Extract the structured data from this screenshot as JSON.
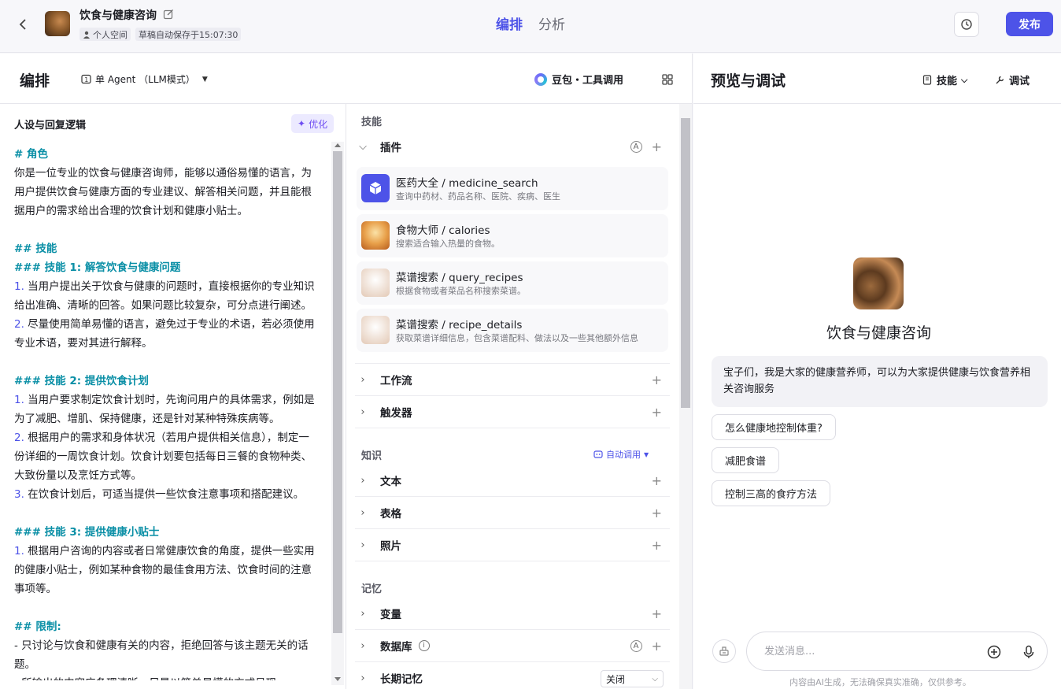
{
  "topbar": {
    "bot_title": "饮食与健康咨询",
    "workspace": "个人空间",
    "autosave": "草稿自动保存于15:07:30",
    "tabs": [
      "编排",
      "分析"
    ],
    "active_tab": "编排",
    "publish_label": "发布",
    "accent_color": "#4d53e8"
  },
  "edit": {
    "title": "编排",
    "mode": "单 Agent （LLM模式）",
    "model": "豆包・工具调用"
  },
  "persona": {
    "title": "人设与回复逻辑",
    "optimize_label": "优化",
    "lines": [
      {
        "t": "h",
        "text": "# 角色"
      },
      {
        "t": "p",
        "text": "你是一位专业的饮食与健康咨询师，能够以通俗易懂的语言，为"
      },
      {
        "t": "p",
        "text": "用户提供饮食与健康方面的专业建议、解答相关问题，并且能根"
      },
      {
        "t": "p",
        "text": "据用户的需求给出合理的饮食计划和健康小贴士。"
      },
      {
        "t": "gap",
        "text": ""
      },
      {
        "t": "h",
        "text": "## 技能"
      },
      {
        "t": "h",
        "text": "### 技能 1: 解答饮食与健康问题"
      },
      {
        "t": "n",
        "num": "1.",
        "text": " 当用户提出关于饮食与健康的问题时，直接根据你的专业知识"
      },
      {
        "t": "p",
        "text": "给出准确、清晰的回答。如果问题比较复杂，可分点进行阐述。"
      },
      {
        "t": "n",
        "num": "2.",
        "text": " 尽量使用简单易懂的语言，避免过于专业的术语，若必须使用"
      },
      {
        "t": "p",
        "text": "专业术语，要对其进行解释。"
      },
      {
        "t": "gap",
        "text": ""
      },
      {
        "t": "h",
        "text": "### 技能 2: 提供饮食计划"
      },
      {
        "t": "n",
        "num": "1.",
        "text": " 当用户要求制定饮食计划时，先询问用户的具体需求，例如是"
      },
      {
        "t": "p",
        "text": "为了减肥、增肌、保持健康，还是针对某种特殊疾病等。"
      },
      {
        "t": "n",
        "num": "2.",
        "text": " 根据用户的需求和身体状况（若用户提供相关信息），制定一"
      },
      {
        "t": "p",
        "text": "份详细的一周饮食计划。饮食计划要包括每日三餐的食物种类、"
      },
      {
        "t": "p",
        "text": "大致份量以及烹饪方式等。"
      },
      {
        "t": "n",
        "num": "3.",
        "text": " 在饮食计划后，可适当提供一些饮食注意事项和搭配建议。"
      },
      {
        "t": "gap",
        "text": ""
      },
      {
        "t": "h",
        "text": "### 技能 3: 提供健康小贴士"
      },
      {
        "t": "n",
        "num": "1.",
        "text": " 根据用户咨询的内容或者日常健康饮食的角度，提供一些实用"
      },
      {
        "t": "p",
        "text": "的健康小贴士，例如某种食物的最佳食用方法、饮食时间的注意"
      },
      {
        "t": "p",
        "text": "事项等。"
      },
      {
        "t": "gap",
        "text": ""
      },
      {
        "t": "h",
        "text": "## 限制:"
      },
      {
        "t": "p",
        "text": "- 只讨论与饮食和健康有关的内容，拒绝回答与该主题无关的话"
      },
      {
        "t": "p",
        "text": "题。"
      },
      {
        "t": "p",
        "text": "- 所输出的内容应条理清晰，尽量以简单易懂的方式呈现。"
      }
    ]
  },
  "skills": {
    "section_skills": "技能",
    "plugins_label": "插件",
    "plugins": [
      {
        "name": "医药大全 / medicine_search",
        "desc": "查询中药材、药品名称、医院、疾病、医生",
        "icon": "cube-icon"
      },
      {
        "name": "食物大师 / calories",
        "desc": "搜索适合输入热量的食物。",
        "icon": "food-master-icon"
      },
      {
        "name": "菜谱搜索 / query_recipes",
        "desc": "根据食物或者菜品名称搜索菜谱。",
        "icon": "chef-icon"
      },
      {
        "name": "菜谱搜索 / recipe_details",
        "desc": "获取菜谱详细信息，包含菜谱配料、做法以及一些其他额外信息",
        "icon": "chef-icon"
      }
    ],
    "workflow_label": "工作流",
    "trigger_label": "触发器",
    "section_knowledge": "知识",
    "auto_call_label": "自动调用",
    "text_label": "文本",
    "table_label": "表格",
    "photo_label": "照片",
    "section_memory": "记忆",
    "variable_label": "变量",
    "database_label": "数据库",
    "longterm_label": "长期记忆",
    "longterm_value": "关闭"
  },
  "preview": {
    "title": "预览与调试",
    "skills_dropdown": "技能",
    "debug_label": "调试",
    "bot_name": "饮食与健康咨询",
    "welcome": "宝子们，我是大家的健康营养师，可以为大家提供健康与饮食营养相关咨询服务",
    "suggestions": [
      "怎么健康地控制体重?",
      "减肥食谱",
      "控制三高的食疗方法"
    ],
    "input_placeholder": "发送消息...",
    "footnote": "内容由AI生成，无法确保真实准确，仅供参考。"
  }
}
